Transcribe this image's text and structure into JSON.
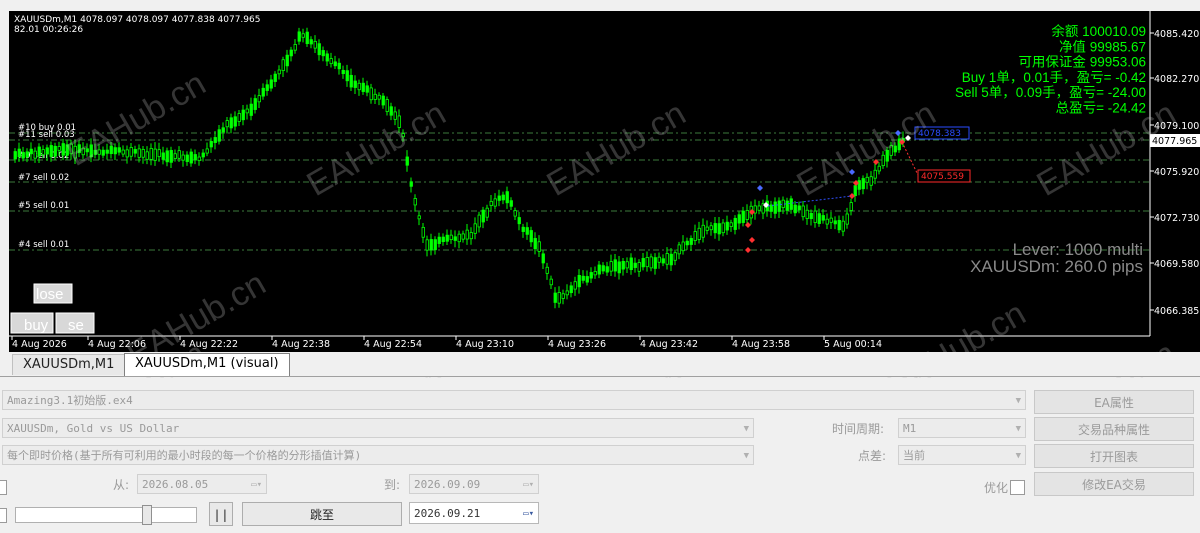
{
  "chart": {
    "header_line1": "XAUUSDm,M1  4078.097 4078.097 4077.838 4077.965",
    "header_line2": "82.01    00:26:26",
    "price_labels": [
      "4085.420",
      "4082.270",
      "4079.100",
      "4075.920",
      "4072.730",
      "4069.580",
      "4066.385"
    ],
    "current_price": "4077.965",
    "time_labels": [
      "4 Aug 2026",
      "4 Aug 22:06",
      "4 Aug 22:22",
      "4 Aug 22:38",
      "4 Aug 22:54",
      "4 Aug 23:10",
      "4 Aug 23:26",
      "4 Aug 23:42",
      "4 Aug 23:58",
      "5 Aug 00:14"
    ],
    "order_lines": [
      {
        "label": "#10 buy 0.01"
      },
      {
        "label": "#11 sell 0.03"
      },
      {
        "label": "#9 sell 0.02"
      },
      {
        "label": "#7 sell 0.02"
      },
      {
        "label": "#5 sell 0.01"
      },
      {
        "label": "#4 sell 0.01"
      }
    ],
    "price_tag_blue": "4078.383",
    "price_tag_red": "4075.559",
    "info": [
      {
        "text": "余额 100010.09"
      },
      {
        "text": "净值 99985.67"
      },
      {
        "text": "可用保证金 99953.06"
      },
      {
        "text": "Buy 1单，0.01手，盈亏= -0.42"
      },
      {
        "text": "Sell 5单，0.09手，盈亏= -24.00"
      },
      {
        "text": "总盈亏= -24.42"
      }
    ],
    "lever_text": "Lever: 1000 multi",
    "pips_text": "XAUUSDm: 260.0 pips",
    "buttons": {
      "close": "lose",
      "buy": "buy",
      "sell": "se"
    },
    "colors": {
      "background": "#000000",
      "candle": "#00ff00",
      "info_text": "#00ff00",
      "order_line": "#3c7a3c",
      "grid_label": "#ffffff"
    },
    "watermark": "EAHub.cn"
  },
  "tabs": [
    {
      "label": "XAUUSDm,M1"
    },
    {
      "label": "XAUUSDm,M1 (visual)"
    }
  ],
  "tester": {
    "expert": "Amazing3.1初始版.ex4",
    "symbol": "XAUUSDm, Gold vs US Dollar",
    "model": "每个即时价格(基于所有可利用的最小时段的每一个价格的分形插值计算)",
    "from_label": "从:",
    "from_date": "2026.08.05",
    "to_label": "到:",
    "to_date": "2026.09.09",
    "period_label": "时间周期:",
    "period_value": "M1",
    "spread_label": "点差:",
    "spread_value": "当前",
    "optimize_label": "优化",
    "skip_label": "跳至",
    "skip_date": "2026.09.21",
    "pause_label": "| |",
    "buttons": {
      "ea_props": "EA属性",
      "symbol_props": "交易品种属性",
      "open_chart": "打开图表",
      "modify_ea": "修改EA交易"
    }
  }
}
